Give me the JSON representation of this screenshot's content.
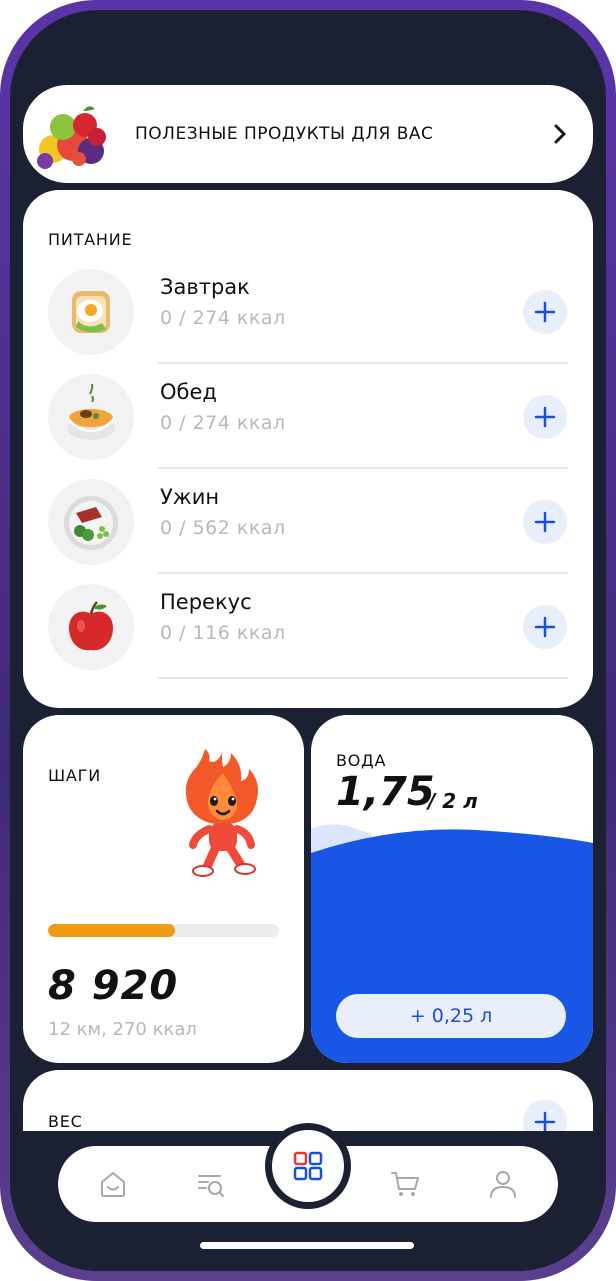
{
  "banner": {
    "title": "ПОЛЕЗНЫЕ ПРОДУКТЫ ДЛЯ ВАС",
    "icon": "fruits-basket-icon",
    "arrow_icon": "chevron-right-icon"
  },
  "nutrition": {
    "title": "ПИТАНИЕ",
    "meals": [
      {
        "name": "Завтрак",
        "kcal": "0 / 274 ккал",
        "icon": "fried-egg-toast-icon"
      },
      {
        "name": "Обед",
        "kcal": "0 / 274 ккал",
        "icon": "soup-bowl-icon"
      },
      {
        "name": "Ужин",
        "kcal": "0 / 562 ккал",
        "icon": "steak-plate-icon"
      },
      {
        "name": "Перекус",
        "kcal": "0 / 116 ккал",
        "icon": "apple-icon"
      }
    ],
    "add_icon": "plus-icon"
  },
  "steps": {
    "title": "ШАГИ",
    "count": "8 920",
    "details": "12 км, 270 ккал",
    "progress": 0.55,
    "progress_color": "#f29a12",
    "mascot_icon": "fire-mascot-icon"
  },
  "water": {
    "title": "ВОДА",
    "value": "1,75",
    "goal": "/ 2 л",
    "add_label": "+ 0,25 л",
    "fill_color": "#1a56e6"
  },
  "weight": {
    "title": "ВЕС"
  },
  "tabbar": {
    "tabs": [
      {
        "name": "home",
        "icon": "home-icon"
      },
      {
        "name": "search-list",
        "icon": "search-list-icon"
      },
      {
        "name": "dashboard",
        "icon": "grid-icon",
        "active": true
      },
      {
        "name": "cart",
        "icon": "cart-icon"
      },
      {
        "name": "profile",
        "icon": "profile-icon"
      }
    ],
    "active_color": "#1a4fd8",
    "accent_color": "#e53935"
  }
}
